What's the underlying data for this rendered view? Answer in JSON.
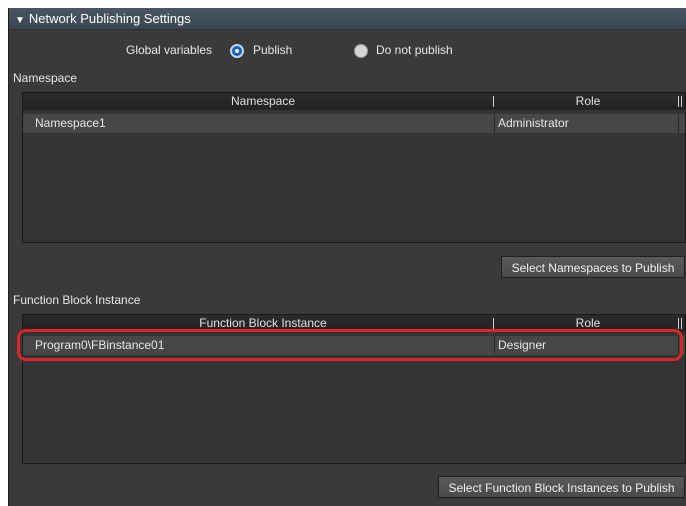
{
  "panel": {
    "title": "Network Publishing Settings",
    "collapse_glyph": "▼"
  },
  "global_variables": {
    "label": "Global variables",
    "options": [
      "Publish",
      "Do not publish"
    ],
    "selected": "Publish"
  },
  "namespace_section": {
    "label": "Namespace",
    "columns": [
      "Namespace",
      "Role"
    ],
    "rows": [
      {
        "name": "Namespace1",
        "role": "Administrator"
      }
    ],
    "button_label": "Select Namespaces to Publish"
  },
  "fb_section": {
    "label": "Function Block Instance",
    "columns": [
      "Function Block Instance",
      "Role"
    ],
    "rows": [
      {
        "name": "Program0\\FBinstance01",
        "role": "Designer"
      }
    ],
    "button_label": "Select Function Block Instances to Publish"
  },
  "colors": {
    "panel_bg": "#3a3a3a",
    "header_bg": "#4a5663",
    "selected_radio": "#1d5fb8",
    "highlight": "#d9262b"
  }
}
